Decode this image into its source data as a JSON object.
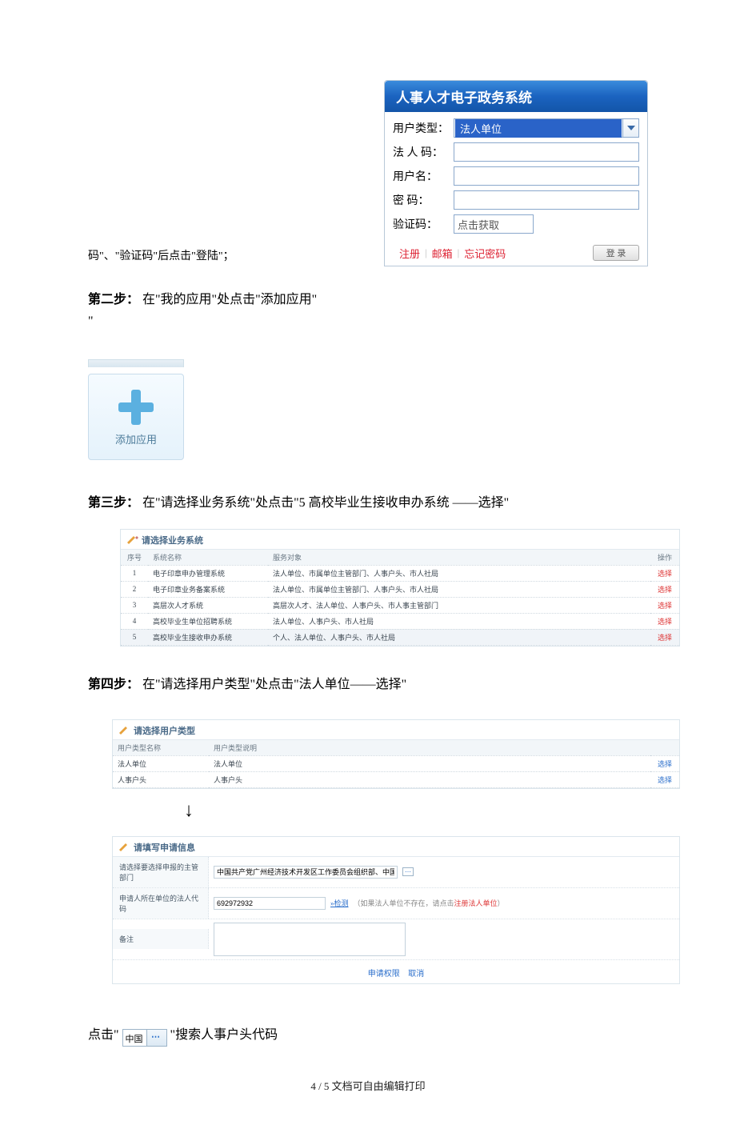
{
  "step1": {
    "trailing_text": "码\"、\"验证码\"后点击\"登陆\"；"
  },
  "login": {
    "title": "人事人才电子政务系统",
    "labels": {
      "user_type": "用户类型：",
      "legal_code": "法 人 码：",
      "username": "用户名：",
      "password": "密   码：",
      "captcha": "验证码："
    },
    "user_type_value": "法人单位",
    "captcha_placeholder": "点击获取",
    "links": {
      "register": "注册",
      "mail": "邮箱",
      "forgot": "忘记密码"
    },
    "login_btn": "登 录"
  },
  "step2": {
    "label": "第二步：",
    "text": "在\"我的应用\"处点击\"添加应用\"",
    "tail": "\""
  },
  "add_tile_label": "添加应用",
  "step3": {
    "label": "第三步：",
    "text": "在\"请选择业务系统\"处点击\"5 高校毕业生接收申办系统  ——选择\""
  },
  "sys_panel": {
    "title": "请选择业务系统",
    "headers": {
      "no": "序号",
      "name": "系统名称",
      "target": "服务对象",
      "op": "操作"
    },
    "rows": [
      {
        "no": "1",
        "name": "电子印章申办管理系统",
        "target": "法人单位、市属单位主管部门、人事户头、市人社局",
        "op": "选择"
      },
      {
        "no": "2",
        "name": "电子印章业务备案系统",
        "target": "法人单位、市属单位主管部门、人事户头、市人社局",
        "op": "选择"
      },
      {
        "no": "3",
        "name": "高层次人才系统",
        "target": "高层次人才、法人单位、人事户头、市人事主管部门",
        "op": "选择"
      },
      {
        "no": "4",
        "name": "高校毕业生单位招聘系统",
        "target": "法人单位、人事户头、市人社局",
        "op": "选择"
      },
      {
        "no": "5",
        "name": "高校毕业生接收申办系统",
        "target": "个人、法人单位、人事户头、市人社局",
        "op": "选择"
      }
    ]
  },
  "step4": {
    "label": "第四步：",
    "text": "在\"请选择用户类型\"处点击\"法人单位——选择\""
  },
  "utype_panel": {
    "title": "请选择用户类型",
    "headers": {
      "name": "用户类型名称",
      "desc": "用户类型说明",
      "op": ""
    },
    "rows": [
      {
        "name": "法人单位",
        "desc": "法人单位",
        "op": "选择"
      },
      {
        "name": "人事户头",
        "desc": "人事户头",
        "op": "选择"
      }
    ]
  },
  "info_panel": {
    "title": "请填写申请信息",
    "rows": {
      "dept": {
        "label": "请选择要选择申报的主管部门",
        "value": "中国共产党广州经济技术开发区工作委员会组织部、中国"
      },
      "code": {
        "label": "申请人所在单位的法人代码",
        "value": "692972932",
        "check": "»检测",
        "hint_pre": "（如果法人单位不存在，请点击",
        "hint_link": "注册法人单位",
        "hint_post": "）"
      },
      "remark": {
        "label": "备注"
      }
    },
    "actions": {
      "apply": "申请权限",
      "cancel": "取消"
    }
  },
  "widget_text": "中国",
  "step5_tail": {
    "pre": "点击\"",
    "post": "\"搜索人事户头代码"
  },
  "footer": "4 / 5 文档可自由编辑打印"
}
